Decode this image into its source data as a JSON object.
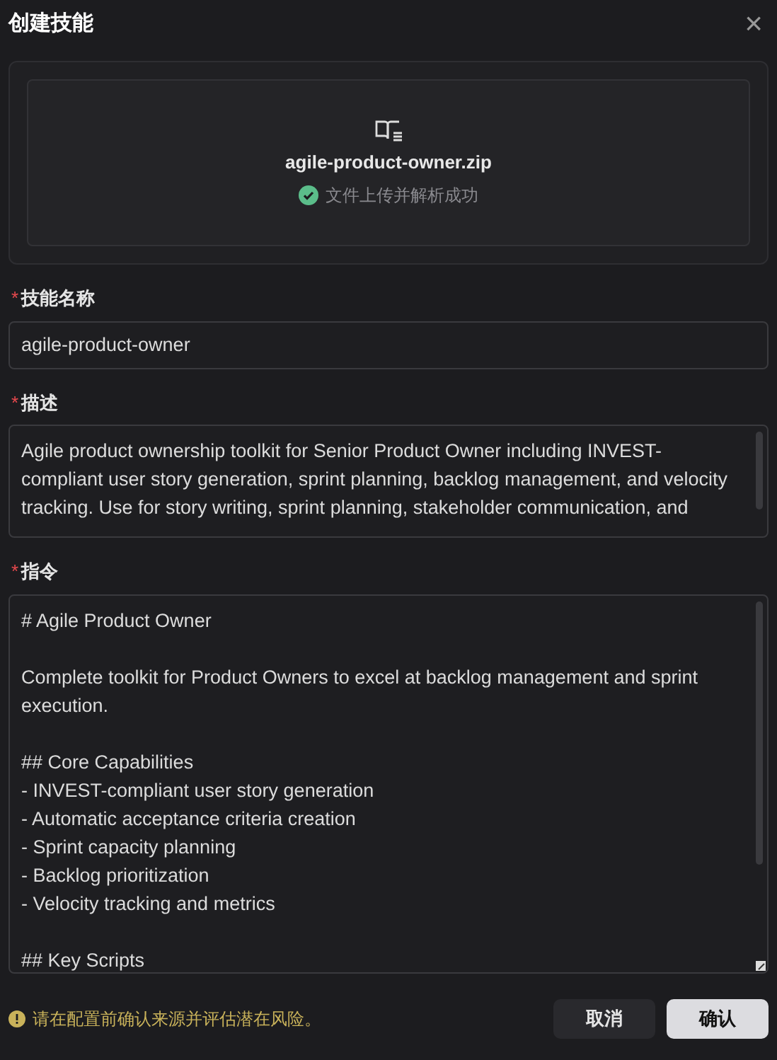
{
  "dialog": {
    "title": "创建技能",
    "close": "×"
  },
  "upload": {
    "filename": "agile-product-owner.zip",
    "status": "文件上传并解析成功",
    "success": true
  },
  "fields": [
    {
      "kind": "input",
      "label": "技能名称",
      "required_mark": "*",
      "value": "agile-product-owner"
    },
    {
      "kind": "textarea",
      "label": "描述",
      "required_mark": "*",
      "value": "Agile product ownership toolkit for Senior Product Owner including INVEST-compliant user story generation, sprint planning, backlog management, and velocity tracking. Use for story writing, sprint planning, stakeholder communication, and"
    },
    {
      "kind": "code",
      "label": "指令",
      "required_mark": "*",
      "value": "# Agile Product Owner\n\nComplete toolkit for Product Owners to excel at backlog management and sprint execution.\n\n## Core Capabilities\n- INVEST-compliant user story generation\n- Automatic acceptance criteria creation\n- Sprint capacity planning\n- Backlog prioritization\n- Velocity tracking and metrics\n\n## Key Scripts"
    }
  ],
  "footer": {
    "warning": "请在配置前确认来源并评估潜在风险。",
    "buttons": [
      {
        "label": "取消",
        "kind": "secondary"
      },
      {
        "label": "确认",
        "kind": "primary"
      }
    ]
  }
}
